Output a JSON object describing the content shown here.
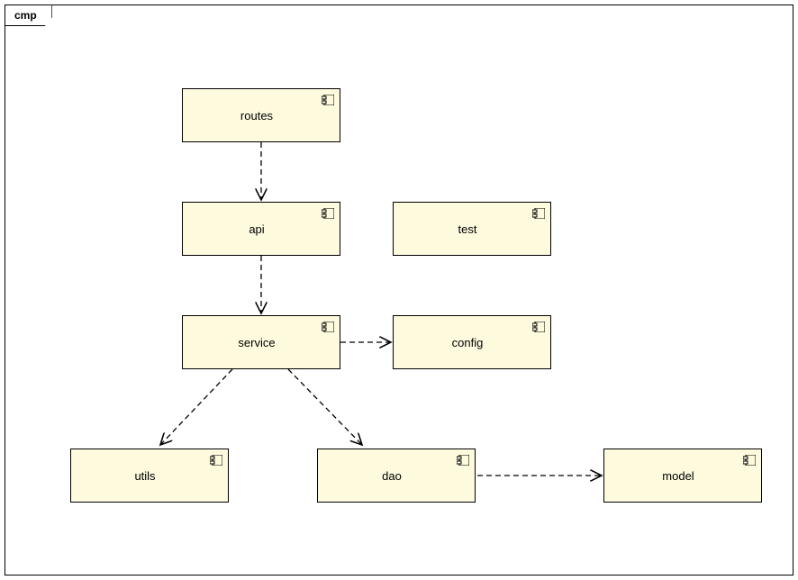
{
  "frame": {
    "label": "cmp"
  },
  "components": {
    "routes": {
      "label": "routes"
    },
    "api": {
      "label": "api"
    },
    "test": {
      "label": "test"
    },
    "service": {
      "label": "service"
    },
    "config": {
      "label": "config"
    },
    "utils": {
      "label": "utils"
    },
    "dao": {
      "label": "dao"
    },
    "model": {
      "label": "model"
    }
  },
  "chart_data": {
    "type": "diagram",
    "diagram_type": "UML Component Diagram",
    "frame_label": "cmp",
    "nodes": [
      {
        "id": "routes",
        "label": "routes",
        "type": "component"
      },
      {
        "id": "api",
        "label": "api",
        "type": "component"
      },
      {
        "id": "test",
        "label": "test",
        "type": "component"
      },
      {
        "id": "service",
        "label": "service",
        "type": "component"
      },
      {
        "id": "config",
        "label": "config",
        "type": "component"
      },
      {
        "id": "utils",
        "label": "utils",
        "type": "component"
      },
      {
        "id": "dao",
        "label": "dao",
        "type": "component"
      },
      {
        "id": "model",
        "label": "model",
        "type": "component"
      }
    ],
    "edges": [
      {
        "from": "routes",
        "to": "api",
        "style": "dashed",
        "type": "dependency"
      },
      {
        "from": "api",
        "to": "service",
        "style": "dashed",
        "type": "dependency"
      },
      {
        "from": "service",
        "to": "config",
        "style": "dashed",
        "type": "dependency"
      },
      {
        "from": "service",
        "to": "utils",
        "style": "dashed",
        "type": "dependency"
      },
      {
        "from": "service",
        "to": "dao",
        "style": "dashed",
        "type": "dependency"
      },
      {
        "from": "dao",
        "to": "model",
        "style": "dashed",
        "type": "dependency"
      }
    ]
  }
}
